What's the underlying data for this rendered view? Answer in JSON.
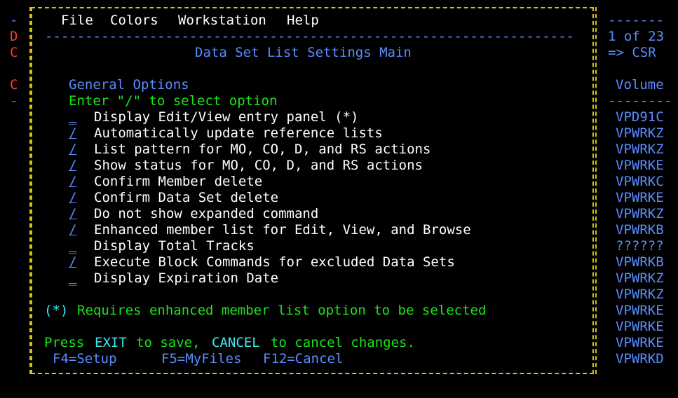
{
  "background_left": {
    "rows": [
      {
        "text": "-",
        "color": "blue"
      },
      {
        "text": "D",
        "color": "red"
      },
      {
        "text": "C",
        "color": "red"
      },
      {
        "text": "",
        "color": "blue"
      },
      {
        "text": "C",
        "color": "red"
      },
      {
        "text": "-",
        "color": "red"
      }
    ]
  },
  "background_right": {
    "dashes_top": "-------",
    "scroll_position": "1 of 23",
    "scroll_label": "=> CSR",
    "column_header": "Volume",
    "column_separator": "--------",
    "volumes": [
      "VPD91C",
      "VPWRKZ",
      "VPWRKZ",
      "VPWRKE",
      "VPWRKC",
      "VPWRKE",
      "VPWRKZ",
      "VPWRKB",
      "??????",
      "VPWRKB",
      "VPWRKZ",
      "VPWRKZ",
      "VPWRKE",
      "VPWRKE",
      "VPWRKE",
      "VPWRKD"
    ]
  },
  "menubar": {
    "items": [
      "File",
      "Colors",
      "Workstation",
      "Help"
    ]
  },
  "separator": "-------------------------------------------------------------------------------------",
  "panel": {
    "title": "Data Set List Settings Main",
    "section_title": "General Options",
    "instruction": "Enter \"/\" to select option",
    "options": [
      {
        "selected": false,
        "mark": "_",
        "label": "Display Edit/View entry panel (*)"
      },
      {
        "selected": true,
        "mark": "/",
        "label": "Automatically update reference lists"
      },
      {
        "selected": true,
        "mark": "/",
        "label": "List pattern for MO, CO, D, and RS actions"
      },
      {
        "selected": true,
        "mark": "/",
        "label": "Show status for MO, CO, D, and RS actions"
      },
      {
        "selected": true,
        "mark": "/",
        "label": "Confirm Member delete"
      },
      {
        "selected": true,
        "mark": "/",
        "label": "Confirm Data Set delete"
      },
      {
        "selected": true,
        "mark": "/",
        "label": "Do not show expanded command"
      },
      {
        "selected": true,
        "mark": "/",
        "label": "Enhanced member list for Edit, View, and Browse"
      },
      {
        "selected": false,
        "mark": "_",
        "label": "Display Total Tracks"
      },
      {
        "selected": true,
        "mark": "/",
        "label": "Execute Block Commands for excluded Data Sets"
      },
      {
        "selected": false,
        "mark": "_",
        "label": "Display Expiration Date"
      }
    ],
    "note_marker": "(*)",
    "note_text": "Requires enhanced member list option to be selected",
    "footer_press": "Press",
    "footer_exit": "EXIT",
    "footer_to_save": "to save,",
    "footer_cancel": "CANCEL",
    "footer_to_cancel": "to cancel changes.",
    "fkeys": [
      "F4=Setup",
      "F5=MyFiles",
      "F12=Cancel"
    ]
  },
  "colors": {
    "border": "#d8c400",
    "text_white": "#ffffff",
    "text_blue": "#5a8cff",
    "text_green": "#19e619",
    "text_turquoise": "#38e8ee",
    "text_red": "#ff3b3b"
  }
}
